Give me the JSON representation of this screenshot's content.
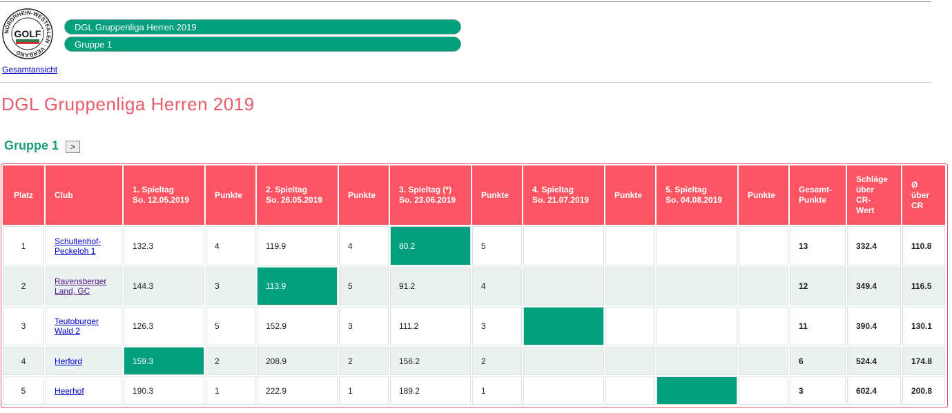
{
  "header": {
    "logo_text": "GOLF",
    "logo_ring_text": "NORDRHEIN-WESTFALEN · VERBAND · ",
    "breadcrumb_league": "DGL Gruppenliga Herren 2019",
    "breadcrumb_group": "Gruppe 1",
    "overview_link": "Gesamtansicht"
  },
  "page_title": "DGL Gruppenliga Herren 2019",
  "group_title": "Gruppe 1",
  "next_button": ">",
  "colors": {
    "accent_green": "#009f7d",
    "header_red": "#fb5563",
    "title_red": "#e85a6a"
  },
  "table": {
    "headers": {
      "platz": "Platz",
      "club": "Club",
      "s1_l1": "1. Spieltag",
      "s1_l2": "So. 12.05.2019",
      "p1": "Punkte",
      "s2_l1": "2. Spieltag",
      "s2_l2": "So. 26.05.2019",
      "p2": "Punkte",
      "s3_l1": "3. Spieltag (*)",
      "s3_l2": "So. 23.06.2019",
      "p3": "Punkte",
      "s4_l1": "4. Spieltag",
      "s4_l2": "So. 21.07.2019",
      "p4": "Punkte",
      "s5_l1": "5. Spieltag",
      "s5_l2": "So. 04.08.2019",
      "p5": "Punkte",
      "gesamt_l1": "Gesamt-",
      "gesamt_l2": "Punkte",
      "schlaege_l1": "Schläge",
      "schlaege_l2": "über",
      "schlaege_l3": "CR-",
      "schlaege_l4": "Wert",
      "avg_l1": "Ø",
      "avg_l2": "über",
      "avg_l3": "CR"
    },
    "rows": [
      {
        "platz": "1",
        "club_l1": "Schultenhof-",
        "club_l2": "Peckeloh 1",
        "s1": "132.3",
        "p1": "4",
        "s2": "119.9",
        "p2": "4",
        "s3": "80.2",
        "p3": "5",
        "s4": "",
        "p4": "",
        "s5": "",
        "p5": "",
        "gesamt": "13",
        "schlaege": "332.4",
        "avg": "110.8",
        "best_round": 3
      },
      {
        "platz": "2",
        "club_l1": "Ravensberger",
        "club_l2": "Land, GC",
        "s1": "144.3",
        "p1": "3",
        "s2": "113.9",
        "p2": "5",
        "s3": "91.2",
        "p3": "4",
        "s4": "",
        "p4": "",
        "s5": "",
        "p5": "",
        "gesamt": "12",
        "schlaege": "349.4",
        "avg": "116.5",
        "best_round": 2
      },
      {
        "platz": "3",
        "club_l1": "Teutoburger",
        "club_l2": "Wald 2",
        "s1": "126.3",
        "p1": "5",
        "s2": "152.9",
        "p2": "3",
        "s3": "111.2",
        "p3": "3",
        "s4": "",
        "p4": "",
        "s5": "",
        "p5": "",
        "gesamt": "11",
        "schlaege": "390.4",
        "avg": "130.1",
        "best_round": 4
      },
      {
        "platz": "4",
        "club_l1": "Herford",
        "club_l2": "",
        "s1": "159.3",
        "p1": "2",
        "s2": "208.9",
        "p2": "2",
        "s3": "156.2",
        "p3": "2",
        "s4": "",
        "p4": "",
        "s5": "",
        "p5": "",
        "gesamt": "6",
        "schlaege": "524.4",
        "avg": "174.8",
        "best_round": 1
      },
      {
        "platz": "5",
        "club_l1": "Heerhof",
        "club_l2": "",
        "s1": "190.3",
        "p1": "1",
        "s2": "222.9",
        "p2": "1",
        "s3": "189.2",
        "p3": "1",
        "s4": "",
        "p4": "",
        "s5": "",
        "p5": "",
        "gesamt": "3",
        "schlaege": "602.4",
        "avg": "200.8",
        "best_round": 5
      }
    ]
  }
}
